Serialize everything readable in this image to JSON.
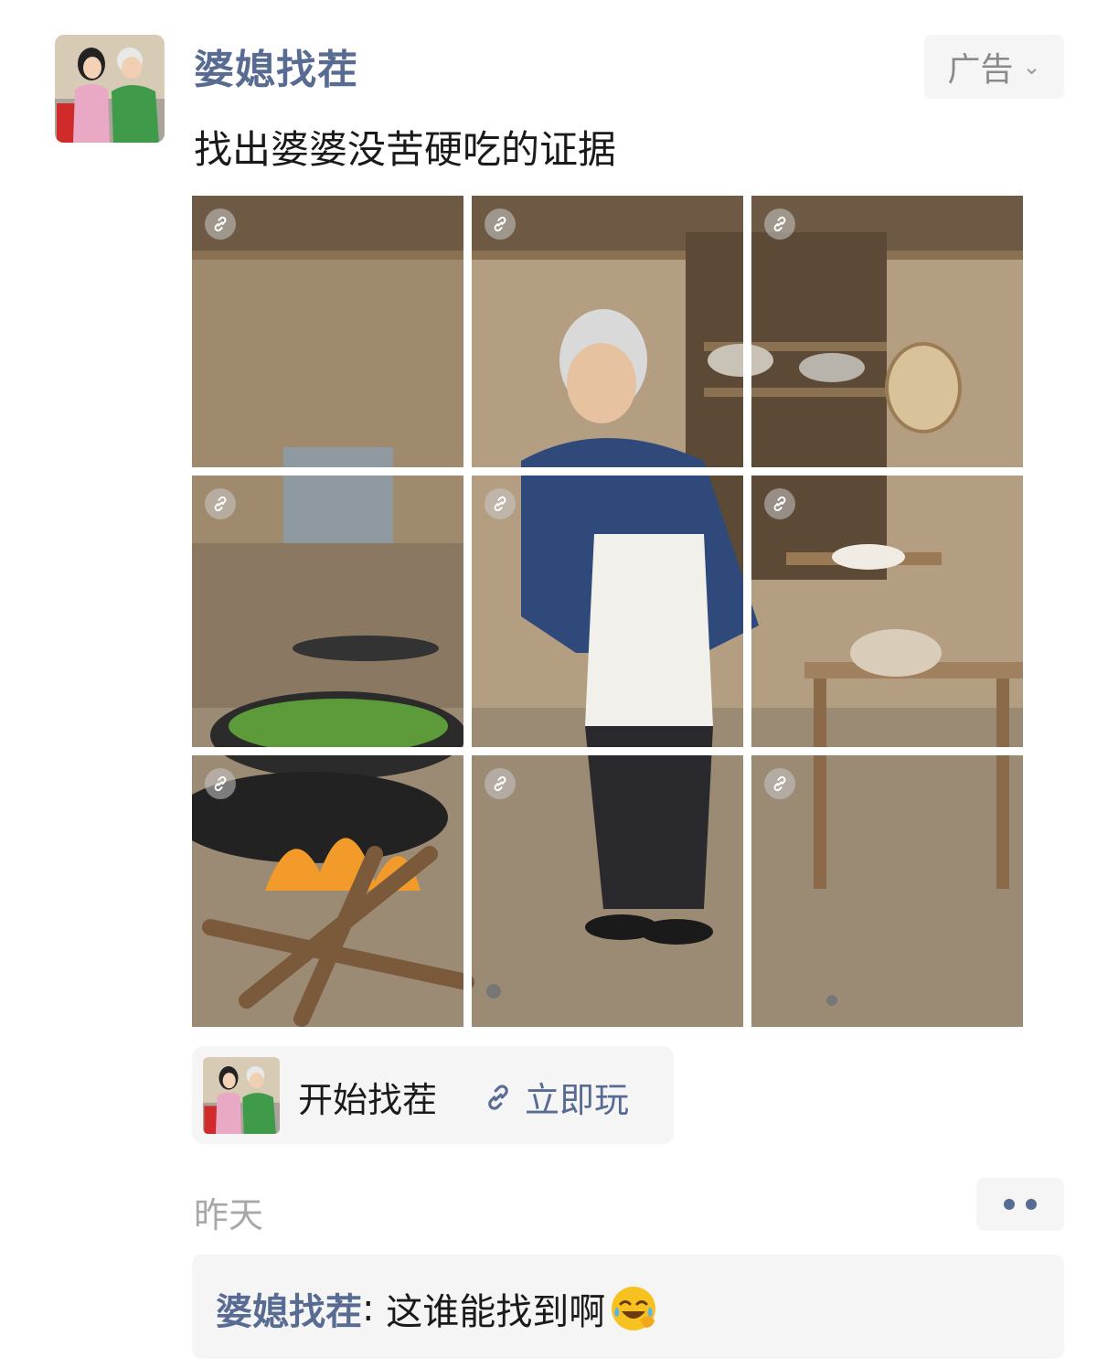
{
  "post": {
    "author": "婆媳找茬",
    "ad_label": "广告",
    "caption": "找出婆婆没苦硬吃的证据",
    "image_count": 9
  },
  "card": {
    "title": "开始找茬",
    "action": "立即玩"
  },
  "meta": {
    "time": "昨天"
  },
  "comment": {
    "author": "婆媳找茬",
    "separator": ": ",
    "text": "这谁能找到啊",
    "emoji": "face-with-tears-of-joy"
  },
  "colors": {
    "name_blue": "#586b93",
    "panel_gray": "#f5f5f6",
    "muted_text": "#a8a8a8"
  }
}
